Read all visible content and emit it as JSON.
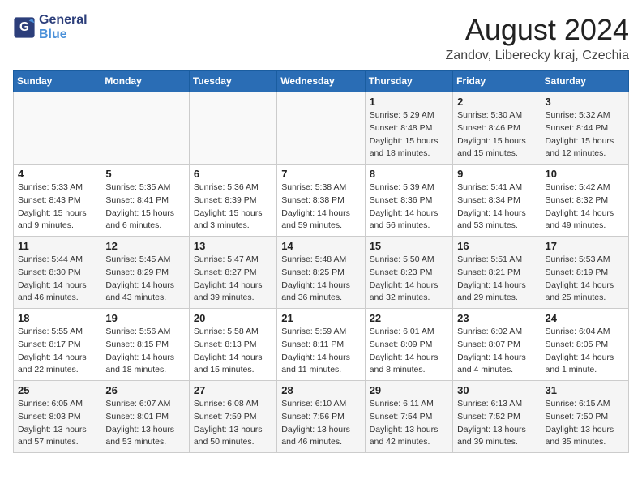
{
  "header": {
    "logo_line1": "General",
    "logo_line2": "Blue",
    "month": "August 2024",
    "location": "Zandov, Liberecky kraj, Czechia"
  },
  "weekdays": [
    "Sunday",
    "Monday",
    "Tuesday",
    "Wednesday",
    "Thursday",
    "Friday",
    "Saturday"
  ],
  "weeks": [
    [
      {
        "day": "",
        "detail": ""
      },
      {
        "day": "",
        "detail": ""
      },
      {
        "day": "",
        "detail": ""
      },
      {
        "day": "",
        "detail": ""
      },
      {
        "day": "1",
        "detail": "Sunrise: 5:29 AM\nSunset: 8:48 PM\nDaylight: 15 hours\nand 18 minutes."
      },
      {
        "day": "2",
        "detail": "Sunrise: 5:30 AM\nSunset: 8:46 PM\nDaylight: 15 hours\nand 15 minutes."
      },
      {
        "day": "3",
        "detail": "Sunrise: 5:32 AM\nSunset: 8:44 PM\nDaylight: 15 hours\nand 12 minutes."
      }
    ],
    [
      {
        "day": "4",
        "detail": "Sunrise: 5:33 AM\nSunset: 8:43 PM\nDaylight: 15 hours\nand 9 minutes."
      },
      {
        "day": "5",
        "detail": "Sunrise: 5:35 AM\nSunset: 8:41 PM\nDaylight: 15 hours\nand 6 minutes."
      },
      {
        "day": "6",
        "detail": "Sunrise: 5:36 AM\nSunset: 8:39 PM\nDaylight: 15 hours\nand 3 minutes."
      },
      {
        "day": "7",
        "detail": "Sunrise: 5:38 AM\nSunset: 8:38 PM\nDaylight: 14 hours\nand 59 minutes."
      },
      {
        "day": "8",
        "detail": "Sunrise: 5:39 AM\nSunset: 8:36 PM\nDaylight: 14 hours\nand 56 minutes."
      },
      {
        "day": "9",
        "detail": "Sunrise: 5:41 AM\nSunset: 8:34 PM\nDaylight: 14 hours\nand 53 minutes."
      },
      {
        "day": "10",
        "detail": "Sunrise: 5:42 AM\nSunset: 8:32 PM\nDaylight: 14 hours\nand 49 minutes."
      }
    ],
    [
      {
        "day": "11",
        "detail": "Sunrise: 5:44 AM\nSunset: 8:30 PM\nDaylight: 14 hours\nand 46 minutes."
      },
      {
        "day": "12",
        "detail": "Sunrise: 5:45 AM\nSunset: 8:29 PM\nDaylight: 14 hours\nand 43 minutes."
      },
      {
        "day": "13",
        "detail": "Sunrise: 5:47 AM\nSunset: 8:27 PM\nDaylight: 14 hours\nand 39 minutes."
      },
      {
        "day": "14",
        "detail": "Sunrise: 5:48 AM\nSunset: 8:25 PM\nDaylight: 14 hours\nand 36 minutes."
      },
      {
        "day": "15",
        "detail": "Sunrise: 5:50 AM\nSunset: 8:23 PM\nDaylight: 14 hours\nand 32 minutes."
      },
      {
        "day": "16",
        "detail": "Sunrise: 5:51 AM\nSunset: 8:21 PM\nDaylight: 14 hours\nand 29 minutes."
      },
      {
        "day": "17",
        "detail": "Sunrise: 5:53 AM\nSunset: 8:19 PM\nDaylight: 14 hours\nand 25 minutes."
      }
    ],
    [
      {
        "day": "18",
        "detail": "Sunrise: 5:55 AM\nSunset: 8:17 PM\nDaylight: 14 hours\nand 22 minutes."
      },
      {
        "day": "19",
        "detail": "Sunrise: 5:56 AM\nSunset: 8:15 PM\nDaylight: 14 hours\nand 18 minutes."
      },
      {
        "day": "20",
        "detail": "Sunrise: 5:58 AM\nSunset: 8:13 PM\nDaylight: 14 hours\nand 15 minutes."
      },
      {
        "day": "21",
        "detail": "Sunrise: 5:59 AM\nSunset: 8:11 PM\nDaylight: 14 hours\nand 11 minutes."
      },
      {
        "day": "22",
        "detail": "Sunrise: 6:01 AM\nSunset: 8:09 PM\nDaylight: 14 hours\nand 8 minutes."
      },
      {
        "day": "23",
        "detail": "Sunrise: 6:02 AM\nSunset: 8:07 PM\nDaylight: 14 hours\nand 4 minutes."
      },
      {
        "day": "24",
        "detail": "Sunrise: 6:04 AM\nSunset: 8:05 PM\nDaylight: 14 hours\nand 1 minute."
      }
    ],
    [
      {
        "day": "25",
        "detail": "Sunrise: 6:05 AM\nSunset: 8:03 PM\nDaylight: 13 hours\nand 57 minutes."
      },
      {
        "day": "26",
        "detail": "Sunrise: 6:07 AM\nSunset: 8:01 PM\nDaylight: 13 hours\nand 53 minutes."
      },
      {
        "day": "27",
        "detail": "Sunrise: 6:08 AM\nSunset: 7:59 PM\nDaylight: 13 hours\nand 50 minutes."
      },
      {
        "day": "28",
        "detail": "Sunrise: 6:10 AM\nSunset: 7:56 PM\nDaylight: 13 hours\nand 46 minutes."
      },
      {
        "day": "29",
        "detail": "Sunrise: 6:11 AM\nSunset: 7:54 PM\nDaylight: 13 hours\nand 42 minutes."
      },
      {
        "day": "30",
        "detail": "Sunrise: 6:13 AM\nSunset: 7:52 PM\nDaylight: 13 hours\nand 39 minutes."
      },
      {
        "day": "31",
        "detail": "Sunrise: 6:15 AM\nSunset: 7:50 PM\nDaylight: 13 hours\nand 35 minutes."
      }
    ]
  ]
}
